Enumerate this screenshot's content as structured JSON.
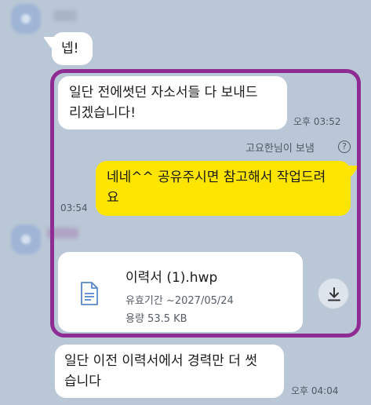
{
  "messages": [
    {
      "text": "넵!"
    },
    {
      "line1": "일단 전에썻던 자소서들 다 보내드",
      "line2": "리겠습니다!",
      "time": "오후 03:52"
    },
    {
      "sent_by": "고요한님이 보냄",
      "help": "?"
    },
    {
      "line1": "네네^^ 공유주시면 참고해서 작업드려",
      "line2": "요",
      "time": "03:54"
    },
    {
      "line1": "일단 이전 이력서에서 경력만 더 썻",
      "line2": "습니다",
      "time": "오후 04:04"
    }
  ],
  "file": {
    "name": "이력서 (1).hwp",
    "expiry": "유효기간 ~2027/05/24",
    "size": "용량 53.5 KB",
    "icon": "document-icon",
    "action_icon": "download-icon"
  },
  "colors": {
    "background": "#bac7d6",
    "my_bubble": "#fee500",
    "other_bubble": "#ffffff",
    "highlight": "#8e2c94"
  }
}
